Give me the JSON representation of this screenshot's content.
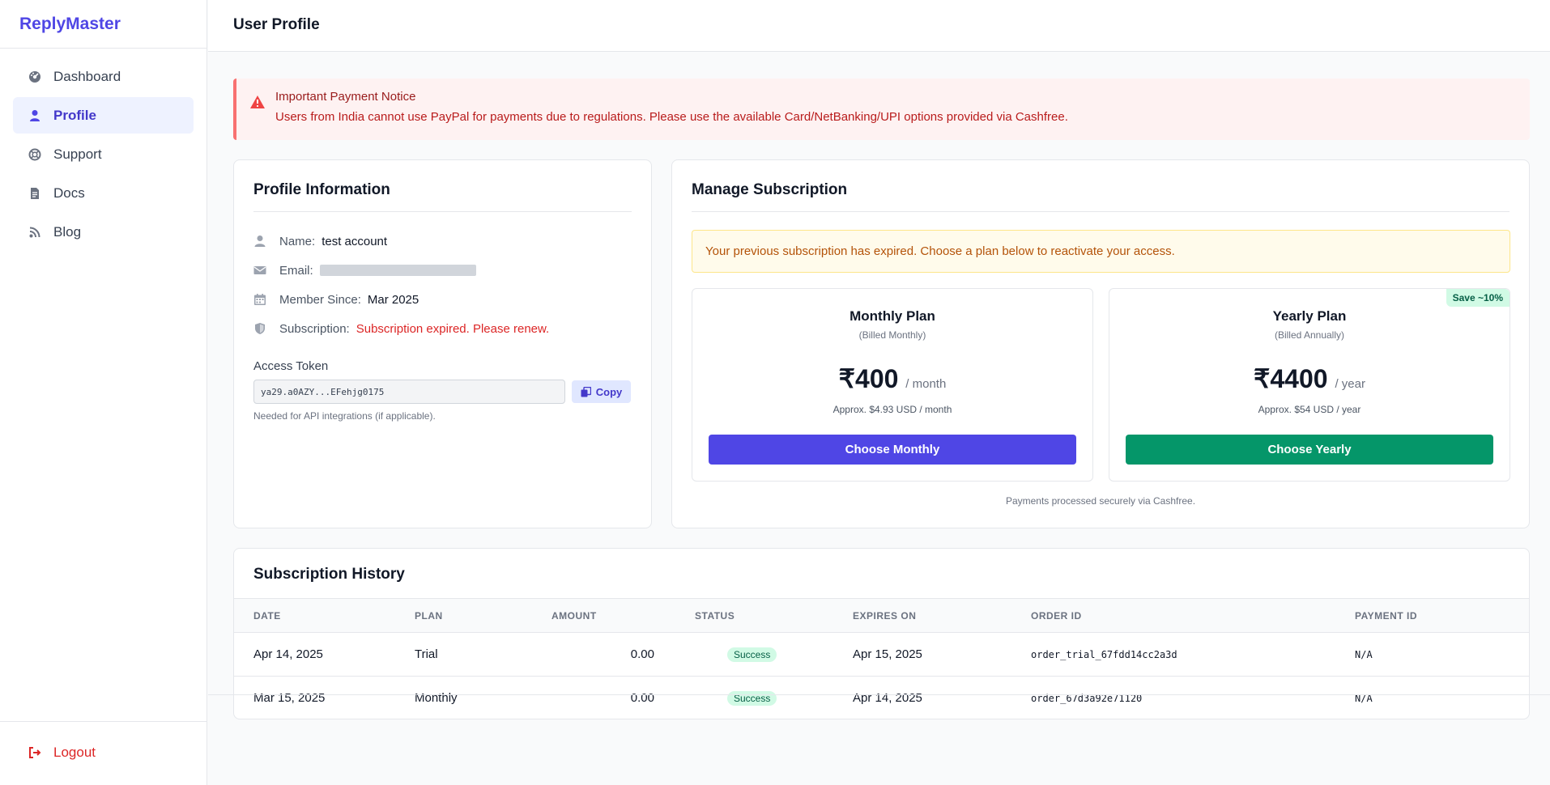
{
  "app": {
    "brand": "ReplyMaster",
    "page_title": "User Profile"
  },
  "sidebar": {
    "items": [
      {
        "label": "Dashboard",
        "icon": "dashboard-icon"
      },
      {
        "label": "Profile",
        "icon": "user-icon",
        "active": true
      },
      {
        "label": "Support",
        "icon": "lifebuoy-icon"
      },
      {
        "label": "Docs",
        "icon": "document-icon"
      },
      {
        "label": "Blog",
        "icon": "rss-icon"
      }
    ],
    "logout": "Logout"
  },
  "alert": {
    "title": "Important Payment Notice",
    "text": "Users from India cannot use PayPal for payments due to regulations. Please use the available Card/NetBanking/UPI options provided via Cashfree."
  },
  "profile": {
    "title": "Profile Information",
    "name_label": "Name:",
    "name_value": "test account",
    "email_label": "Email:",
    "member_label": "Member Since:",
    "member_value": "Mar 2025",
    "subscription_label": "Subscription:",
    "subscription_value": "Subscription expired. Please renew.",
    "token_label": "Access Token",
    "token_value": "ya29.a0AZY...EFehjg0175",
    "copy_label": "Copy",
    "token_help": "Needed for API integrations (if applicable)."
  },
  "subscription": {
    "title": "Manage Subscription",
    "expired_notice": "Your previous subscription has expired. Choose a plan below to reactivate your access.",
    "monthly": {
      "name": "Monthly Plan",
      "billing": "(Billed Monthly)",
      "price": "₹400",
      "unit": "/ month",
      "approx": "Approx. $4.93 USD / month",
      "button": "Choose Monthly"
    },
    "yearly": {
      "name": "Yearly Plan",
      "billing": "(Billed Annually)",
      "price": "₹4400",
      "unit": "/ year",
      "approx": "Approx. $54 USD / year",
      "button": "Choose Yearly",
      "badge": "Save ~10%"
    },
    "secure_note": "Payments processed securely via Cashfree."
  },
  "history": {
    "title": "Subscription History",
    "columns": [
      "DATE",
      "PLAN",
      "AMOUNT",
      "STATUS",
      "EXPIRES ON",
      "ORDER ID",
      "PAYMENT ID"
    ],
    "rows": [
      {
        "date": "Apr 14, 2025",
        "plan": "Trial",
        "amount": "0.00",
        "status": "Success",
        "expires": "Apr 15, 2025",
        "order_id": "order_trial_67fdd14cc2a3d",
        "payment_id": "N/A"
      },
      {
        "date": "Mar 15, 2025",
        "plan": "Monthly",
        "amount": "0.00",
        "status": "Success",
        "expires": "Apr 14, 2025",
        "order_id": "order_67d3a92e71120",
        "payment_id": "N/A"
      }
    ]
  },
  "colors": {
    "brand": "#4f46e5",
    "danger": "#dc2626",
    "success": "#059669",
    "warning": "#b45309"
  }
}
